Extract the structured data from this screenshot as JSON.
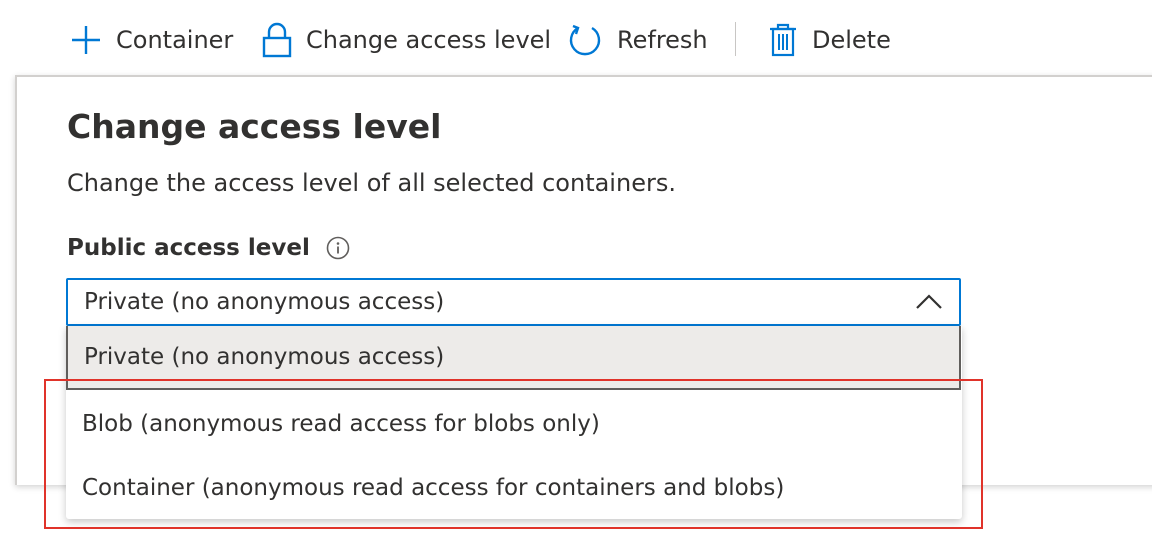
{
  "toolbar": {
    "container_label": "Container",
    "change_access_label": "Change access level",
    "refresh_label": "Refresh",
    "delete_label": "Delete"
  },
  "panel": {
    "title": "Change access level",
    "description": "Change the access level of all selected containers.",
    "field_label": "Public access level"
  },
  "dropdown": {
    "selected_value": "Private (no anonymous access)",
    "options": [
      "Private (no anonymous access)",
      "Blob (anonymous read access for blobs only)",
      "Container (anonymous read access for containers and blobs)"
    ]
  },
  "colors": {
    "accent": "#0078d4",
    "highlight": "#e0332a",
    "text": "#323130",
    "selected_bg": "#edebe9"
  },
  "icons": {
    "container": "plus-icon",
    "change_access": "lock-icon",
    "refresh": "refresh-icon",
    "delete": "trash-icon",
    "info": "info-icon",
    "dropdown": "chevron-up-icon"
  }
}
